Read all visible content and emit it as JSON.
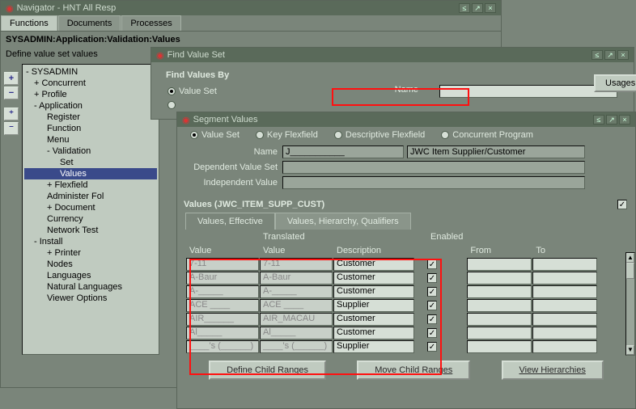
{
  "navigator": {
    "title": "Navigator - HNT All Resp",
    "tabs": {
      "functions": "Functions",
      "documents": "Documents",
      "processes": "Processes"
    },
    "breadcrumb": "SYSADMIN:Application:Validation:Values",
    "subtitle": "Define value set values",
    "tree": [
      {
        "t": "- SYSADMIN",
        "i": 0
      },
      {
        "t": "+ Concurrent",
        "i": 1
      },
      {
        "t": "+ Profile",
        "i": 1
      },
      {
        "t": "- Application",
        "i": 1
      },
      {
        "t": "Register",
        "i": 2
      },
      {
        "t": "Function",
        "i": 2
      },
      {
        "t": "Menu",
        "i": 2
      },
      {
        "t": "- Validation",
        "i": 2
      },
      {
        "t": "Set",
        "i": 3
      },
      {
        "t": "Values",
        "i": 3,
        "sel": true
      },
      {
        "t": "+ Flexfield",
        "i": 2
      },
      {
        "t": "Administer Fol",
        "i": 2
      },
      {
        "t": "+ Document",
        "i": 2
      },
      {
        "t": "Currency",
        "i": 2
      },
      {
        "t": "Network Test",
        "i": 2
      },
      {
        "t": "- Install",
        "i": 1
      },
      {
        "t": "+ Printer",
        "i": 2
      },
      {
        "t": "Nodes",
        "i": 2
      },
      {
        "t": "Languages",
        "i": 2
      },
      {
        "t": "Natural Languages",
        "i": 2
      },
      {
        "t": "Viewer Options",
        "i": 2
      }
    ]
  },
  "find": {
    "title": "Find Value Set",
    "group": "Find Values By",
    "valueset": "Value Set",
    "name_label": "Name",
    "name_value": ""
  },
  "usages_label": "Usages",
  "seg": {
    "title": "Segment Values",
    "radios": {
      "vs": "Value Set",
      "kf": "Key Flexfield",
      "df": "Descriptive Flexfield",
      "cp": "Concurrent Program"
    },
    "labels": {
      "name": "Name",
      "dvs": "Dependent Value Set",
      "iv": "Independent Value"
    },
    "name1": "J___________",
    "name2": "JWC Item Supplier/Customer",
    "values_title": "Values (JWC_ITEM_SUPP_CUST)",
    "tabs": {
      "eff": "Values, Effective",
      "hier": "Values, Hierarchy, Qualifiers"
    },
    "cols": {
      "val": "Value",
      "translated": "Translated",
      "tval": "Value",
      "desc": "Description",
      "enabled": "Enabled",
      "from": "From",
      "to": "To"
    },
    "rows": [
      {
        "v": "7-11",
        "tv": "7-11",
        "d": "Customer"
      },
      {
        "v": "A-Baur",
        "tv": "A-Baur",
        "d": "Customer"
      },
      {
        "v": "A-_____",
        "tv": "A-_____",
        "d": "Customer"
      },
      {
        "v": "ACE ____",
        "tv": "ACE ____",
        "d": "Supplier"
      },
      {
        "v": "AIR______",
        "tv": "AIR_MACAU",
        "d": "Customer"
      },
      {
        "v": "Al_____",
        "tv": "Al_____",
        "d": "Customer"
      },
      {
        "v": "____'s (______)",
        "tv": "____'s (______)",
        "d": "Supplier"
      }
    ],
    "buttons": {
      "define": "Define Child Ranges",
      "move": "Move Child Ranges",
      "view": "View Hierarchies"
    }
  }
}
